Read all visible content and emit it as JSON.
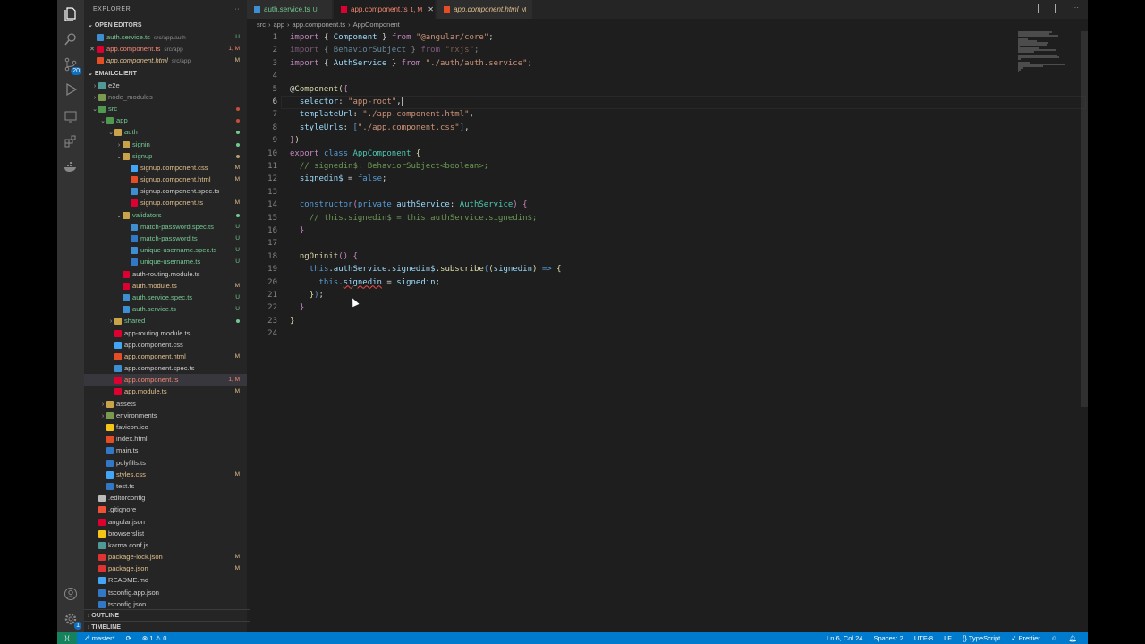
{
  "sidebar": {
    "title": "EXPLORER",
    "more": "···",
    "open_editors_title": "OPEN EDITORS",
    "open_editors": [
      {
        "close": "",
        "name": "auth.service.ts",
        "desc": "src/app/auth",
        "status": "U",
        "color": "c-green",
        "icon": "#3d8fd1",
        "selected": false
      },
      {
        "close": "✕",
        "name": "app.component.ts",
        "desc": "src/app",
        "status": "1, M",
        "color": "c-red",
        "icon": "#dd0031",
        "selected": false
      },
      {
        "close": "",
        "name": "app.component.html",
        "desc": "src/app",
        "status": "M",
        "color": "c-yellow",
        "icon": "#e44d26",
        "selected": false,
        "italic": true
      }
    ],
    "project_title": "EMAILCLIENT",
    "tree": [
      {
        "d": 0,
        "chev": "›",
        "name": "e2e",
        "icon": "#4f9a94",
        "color": "c-white",
        "st": ""
      },
      {
        "d": 0,
        "chev": "›",
        "name": "node_modules",
        "icon": "#7a9a4f",
        "color": "c-white",
        "st": "",
        "dim": true
      },
      {
        "d": 0,
        "chev": "⌄",
        "name": "src",
        "icon": "#4f9a4f",
        "color": "c-green",
        "st": "dot-r"
      },
      {
        "d": 1,
        "chev": "⌄",
        "name": "app",
        "icon": "#4f9a4f",
        "color": "c-green",
        "st": "dot-r"
      },
      {
        "d": 2,
        "chev": "⌄",
        "name": "auth",
        "icon": "#c9a34a",
        "color": "c-green",
        "st": "dot"
      },
      {
        "d": 3,
        "chev": "›",
        "name": "signin",
        "icon": "#c9a34a",
        "color": "c-green",
        "st": "dot"
      },
      {
        "d": 3,
        "chev": "⌄",
        "name": "signup",
        "icon": "#c9a34a",
        "color": "c-green",
        "st": "dot-y"
      },
      {
        "d": 4,
        "chev": "",
        "name": "signup.component.css",
        "icon": "#42a5f5",
        "color": "c-yellow",
        "st": "M"
      },
      {
        "d": 4,
        "chev": "",
        "name": "signup.component.html",
        "icon": "#e44d26",
        "color": "c-yellow",
        "st": "M"
      },
      {
        "d": 4,
        "chev": "",
        "name": "signup.component.spec.ts",
        "icon": "#3d8fd1",
        "color": "c-white",
        "st": ""
      },
      {
        "d": 4,
        "chev": "",
        "name": "signup.component.ts",
        "icon": "#dd0031",
        "color": "c-yellow",
        "st": "M"
      },
      {
        "d": 3,
        "chev": "⌄",
        "name": "validators",
        "icon": "#c9a34a",
        "color": "c-green",
        "st": "dot"
      },
      {
        "d": 4,
        "chev": "",
        "name": "match-password.spec.ts",
        "icon": "#3d8fd1",
        "color": "c-green",
        "st": "U"
      },
      {
        "d": 4,
        "chev": "",
        "name": "match-password.ts",
        "icon": "#3178c6",
        "color": "c-green",
        "st": "U"
      },
      {
        "d": 4,
        "chev": "",
        "name": "unique-username.spec.ts",
        "icon": "#3d8fd1",
        "color": "c-green",
        "st": "U"
      },
      {
        "d": 4,
        "chev": "",
        "name": "unique-username.ts",
        "icon": "#3178c6",
        "color": "c-green",
        "st": "U"
      },
      {
        "d": 3,
        "chev": "",
        "name": "auth-routing.module.ts",
        "icon": "#dd0031",
        "color": "c-white",
        "st": ""
      },
      {
        "d": 3,
        "chev": "",
        "name": "auth.module.ts",
        "icon": "#dd0031",
        "color": "c-yellow",
        "st": "M"
      },
      {
        "d": 3,
        "chev": "",
        "name": "auth.service.spec.ts",
        "icon": "#3d8fd1",
        "color": "c-green",
        "st": "U"
      },
      {
        "d": 3,
        "chev": "",
        "name": "auth.service.ts",
        "icon": "#3d8fd1",
        "color": "c-green",
        "st": "U"
      },
      {
        "d": 2,
        "chev": "›",
        "name": "shared",
        "icon": "#c9a34a",
        "color": "c-green",
        "st": "dot"
      },
      {
        "d": 2,
        "chev": "",
        "name": "app-routing.module.ts",
        "icon": "#dd0031",
        "color": "c-white",
        "st": ""
      },
      {
        "d": 2,
        "chev": "",
        "name": "app.component.css",
        "icon": "#42a5f5",
        "color": "c-white",
        "st": ""
      },
      {
        "d": 2,
        "chev": "",
        "name": "app.component.html",
        "icon": "#e44d26",
        "color": "c-yellow",
        "st": "M"
      },
      {
        "d": 2,
        "chev": "",
        "name": "app.component.spec.ts",
        "icon": "#3d8fd1",
        "color": "c-white",
        "st": ""
      },
      {
        "d": 2,
        "chev": "",
        "name": "app.component.ts",
        "icon": "#dd0031",
        "color": "c-red",
        "st": "1, M",
        "sel": true
      },
      {
        "d": 2,
        "chev": "",
        "name": "app.module.ts",
        "icon": "#dd0031",
        "color": "c-yellow",
        "st": "M"
      },
      {
        "d": 1,
        "chev": "›",
        "name": "assets",
        "icon": "#c9a34a",
        "color": "c-white",
        "st": ""
      },
      {
        "d": 1,
        "chev": "›",
        "name": "environments",
        "icon": "#7a9a4f",
        "color": "c-white",
        "st": ""
      },
      {
        "d": 1,
        "chev": "",
        "name": "favicon.ico",
        "icon": "#f5c518",
        "color": "c-white",
        "st": ""
      },
      {
        "d": 1,
        "chev": "",
        "name": "index.html",
        "icon": "#e44d26",
        "color": "c-white",
        "st": ""
      },
      {
        "d": 1,
        "chev": "",
        "name": "main.ts",
        "icon": "#3178c6",
        "color": "c-white",
        "st": ""
      },
      {
        "d": 1,
        "chev": "",
        "name": "polyfills.ts",
        "icon": "#3178c6",
        "color": "c-white",
        "st": ""
      },
      {
        "d": 1,
        "chev": "",
        "name": "styles.css",
        "icon": "#42a5f5",
        "color": "c-yellow",
        "st": "M"
      },
      {
        "d": 1,
        "chev": "",
        "name": "test.ts",
        "icon": "#3178c6",
        "color": "c-white",
        "st": ""
      },
      {
        "d": 0,
        "chev": "",
        "name": ".editorconfig",
        "icon": "#bbbbbb",
        "color": "c-white",
        "st": ""
      },
      {
        "d": 0,
        "chev": "",
        "name": ".gitignore",
        "icon": "#f05033",
        "color": "c-white",
        "st": ""
      },
      {
        "d": 0,
        "chev": "",
        "name": "angular.json",
        "icon": "#dd0031",
        "color": "c-white",
        "st": ""
      },
      {
        "d": 0,
        "chev": "",
        "name": "browserslist",
        "icon": "#f5c518",
        "color": "c-white",
        "st": ""
      },
      {
        "d": 0,
        "chev": "",
        "name": "karma.conf.js",
        "icon": "#4f9a94",
        "color": "c-white",
        "st": ""
      },
      {
        "d": 0,
        "chev": "",
        "name": "package-lock.json",
        "icon": "#dd3333",
        "color": "c-yellow",
        "st": "M"
      },
      {
        "d": 0,
        "chev": "",
        "name": "package.json",
        "icon": "#dd3333",
        "color": "c-yellow",
        "st": "M"
      },
      {
        "d": 0,
        "chev": "",
        "name": "README.md",
        "icon": "#42a5f5",
        "color": "c-white",
        "st": ""
      },
      {
        "d": 0,
        "chev": "",
        "name": "tsconfig.app.json",
        "icon": "#3178c6",
        "color": "c-white",
        "st": ""
      },
      {
        "d": 0,
        "chev": "",
        "name": "tsconfig.json",
        "icon": "#3178c6",
        "color": "c-white",
        "st": ""
      }
    ],
    "outline_title": "OUTLINE",
    "timeline_title": "TIMELINE"
  },
  "activity": {
    "scm_badge": "20",
    "settings_badge": "1"
  },
  "tabs": [
    {
      "name": "auth.service.ts",
      "mark": "U",
      "icon": "#3d8fd1",
      "active": false,
      "color": "c-green"
    },
    {
      "name": "app.component.ts",
      "mark": "1, M",
      "icon": "#dd0031",
      "active": true,
      "color": "c-red",
      "close": "✕"
    },
    {
      "name": "app.component.html",
      "mark": "M",
      "icon": "#e44d26",
      "active": false,
      "color": "c-yellow",
      "italic": true
    }
  ],
  "breadcrumb": [
    "src",
    "›",
    "app",
    "›",
    "app.component.ts",
    "›",
    "AppComponent"
  ],
  "code_lines": [
    "<span class=\"k\">import</span> <span class=\"p\">{</span> <span class=\"v\">Component</span> <span class=\"p\">}</span> <span class=\"k\">from</span> <span class=\"s\">\"@angular/core\"</span><span class=\"p\">;</span>",
    "<span class=\"dim\"><span class=\"k\">import</span> <span class=\"p\">{</span> <span class=\"v\">BehaviorSubject</span> <span class=\"p\">}</span> <span class=\"k\">from</span> <span class=\"s\">\"rxjs\"</span><span class=\"p\">;</span></span>",
    "<span class=\"k\">import</span> <span class=\"p\">{</span> <span class=\"v\">AuthService</span> <span class=\"p\">}</span> <span class=\"k\">from</span> <span class=\"s\">\"./auth/auth.service\"</span><span class=\"p\">;</span>",
    "",
    "<span class=\"p\">@</span><span class=\"f\">Component</span><span class=\"f\">(</span><span class=\"k\">{</span>",
    "  <span class=\"v\">selector</span><span class=\"p\">:</span> <span class=\"s\">\"app-root\"</span><span class=\"p\">,</span><span class=\"cursor-i\"></span>",
    "  <span class=\"v\">templateUrl</span><span class=\"p\">:</span> <span class=\"s\">\"./app.component.html\"</span><span class=\"p\">,</span>",
    "  <span class=\"v\">styleUrls</span><span class=\"p\">:</span> <span class=\"kb\">[</span><span class=\"s\">\"./app.component.css\"</span><span class=\"kb\">]</span><span class=\"p\">,</span>",
    "<span class=\"k\">}</span><span class=\"f\">)</span>",
    "<span class=\"k\">export</span> <span class=\"kb\">class</span> <span class=\"t\">AppComponent</span> <span class=\"f\">{</span>",
    "  <span class=\"cm\">// signedin$: BehaviorSubject&lt;boolean&gt;;</span>",
    "  <span class=\"v\">signedin$</span> <span class=\"p\">=</span> <span class=\"kb\">false</span><span class=\"p\">;</span>",
    "",
    "  <span class=\"kb\">constructor</span><span class=\"k\">(</span><span class=\"kb\">private</span> <span class=\"v\">authService</span><span class=\"p\">:</span> <span class=\"t\">AuthService</span><span class=\"k\">)</span> <span class=\"k\">{</span>",
    "    <span class=\"cm\">// this.signedin$ = this.authService.signedin$;</span>",
    "  <span class=\"k\">}</span>",
    "",
    "  <span class=\"f\">ngOninit</span><span class=\"k\">()</span> <span class=\"k\">{</span>",
    "    <span class=\"kb\">this</span><span class=\"p\">.</span><span class=\"v\">authService</span><span class=\"p\">.</span><span class=\"v\">signedin$</span><span class=\"p\">.</span><span class=\"f\">subscribe</span><span class=\"kb\">(</span><span class=\"f\">(</span><span class=\"v\">signedin</span><span class=\"f\">)</span> <span class=\"kb\">=&gt;</span> <span class=\"f\">{</span>",
    "      <span class=\"kb\">this</span><span class=\"p\">.</span><span class=\"v squig\">signedin</span> <span class=\"p\">=</span> <span class=\"v\">signedin</span><span class=\"p\">;</span>",
    "    <span class=\"f\">}</span><span class=\"kb\">)</span><span class=\"p\">;</span>",
    "  <span class=\"k\">}</span>",
    "<span class=\"f\">}</span>",
    ""
  ],
  "current_line": 6,
  "status": {
    "branch": "master*",
    "sync": "⟳",
    "problems": "⊗ 1 ⚠ 0",
    "position": "Ln 6, Col 24",
    "spaces": "Spaces: 2",
    "encoding": "UTF-8",
    "eol": "LF",
    "language": "{} TypeScript",
    "formatter": "✓ Prettier"
  }
}
